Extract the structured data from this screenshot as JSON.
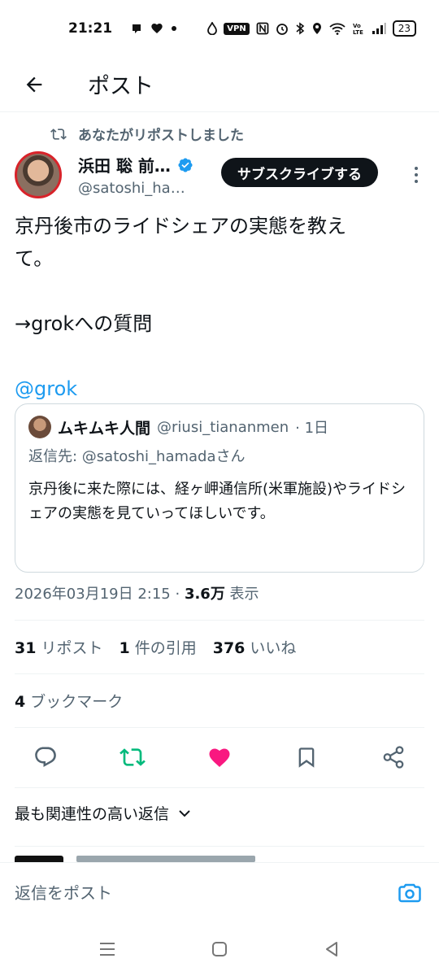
{
  "status_bar": {
    "time": "21:21",
    "vpn_label": "VPN",
    "battery": "23",
    "icons": [
      "notification-icon",
      "heart-icon",
      "dot-icon",
      "drop-icon",
      "vpn-icon",
      "nfc-icon",
      "alarm-icon",
      "bluetooth-icon",
      "location-icon",
      "wifi-icon",
      "volte-icon",
      "signal-icon",
      "battery-icon"
    ]
  },
  "header": {
    "title": "ポスト"
  },
  "repost_context": "あなたがリポストしました",
  "author": {
    "name": "浜田 聡 前…",
    "handle": "@satoshi_ha…",
    "subscribe_label": "サブスクライブする"
  },
  "post": {
    "lines": [
      "京丹後市のライドシェアの実態を教え",
      "て。",
      "",
      "→grokへの質問",
      ""
    ],
    "mention": "@grok"
  },
  "quote": {
    "name": "ムキムキ人間",
    "handle": "@riusi_tiananmen",
    "time": "· 1日",
    "reply_to": "返信先: @satoshi_hamadaさん",
    "text": "京丹後に来た際には、経ヶ岬通信所(米軍施設)やライドシェアの実態を見ていってほしいです。"
  },
  "meta": {
    "datetime": "2026年03月19日 2:15 · ",
    "views": "3.6万",
    "views_label": " 表示"
  },
  "stats": {
    "reposts": "31",
    "reposts_label": "リポスト",
    "quotes": "1",
    "quotes_label": "件の引用",
    "likes": "376",
    "likes_label": "いいね",
    "bookmarks": "4",
    "bookmarks_label": "ブックマーク"
  },
  "sort": {
    "label": "最も関連性の高い返信"
  },
  "reply": {
    "placeholder": "返信をポスト"
  },
  "colors": {
    "accent": "#1d9bf0",
    "repost_active": "#00ba7c",
    "like_active": "#f91880",
    "text_secondary": "#536471"
  }
}
